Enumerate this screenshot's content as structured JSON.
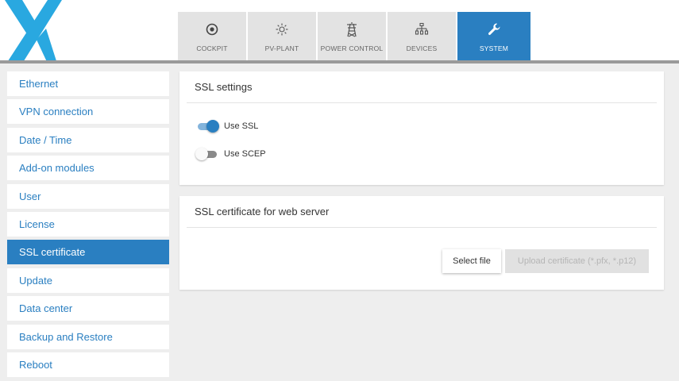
{
  "brand": {
    "accent": "#2a7fc1"
  },
  "nav": {
    "tabs": [
      {
        "label": "COCKPIT",
        "icon": "target-icon",
        "active": false
      },
      {
        "label": "PV-PLANT",
        "icon": "sun-icon",
        "active": false
      },
      {
        "label": "POWER CONTROL",
        "icon": "power-tower-icon",
        "active": false
      },
      {
        "label": "DEVICES",
        "icon": "network-icon",
        "active": false
      },
      {
        "label": "SYSTEM",
        "icon": "wrench-icon",
        "active": true
      }
    ]
  },
  "sidebar": {
    "items": [
      {
        "label": "Ethernet",
        "active": false
      },
      {
        "label": "VPN connection",
        "active": false
      },
      {
        "label": "Date / Time",
        "active": false
      },
      {
        "label": "Add-on modules",
        "active": false
      },
      {
        "label": "User",
        "active": false
      },
      {
        "label": "License",
        "active": false
      },
      {
        "label": "SSL certificate",
        "active": true
      },
      {
        "label": "Update",
        "active": false
      },
      {
        "label": "Data center",
        "active": false
      },
      {
        "label": "Backup and Restore",
        "active": false
      },
      {
        "label": "Reboot",
        "active": false
      }
    ]
  },
  "ssl_settings": {
    "title": "SSL settings",
    "use_ssl": {
      "label": "Use SSL",
      "enabled": true
    },
    "use_scep": {
      "label": "Use SCEP",
      "enabled": false
    }
  },
  "ssl_certificate": {
    "title": "SSL certificate for web server",
    "select_file_label": "Select file",
    "upload_label": "Upload certificate (*.pfx, *.p12)"
  }
}
